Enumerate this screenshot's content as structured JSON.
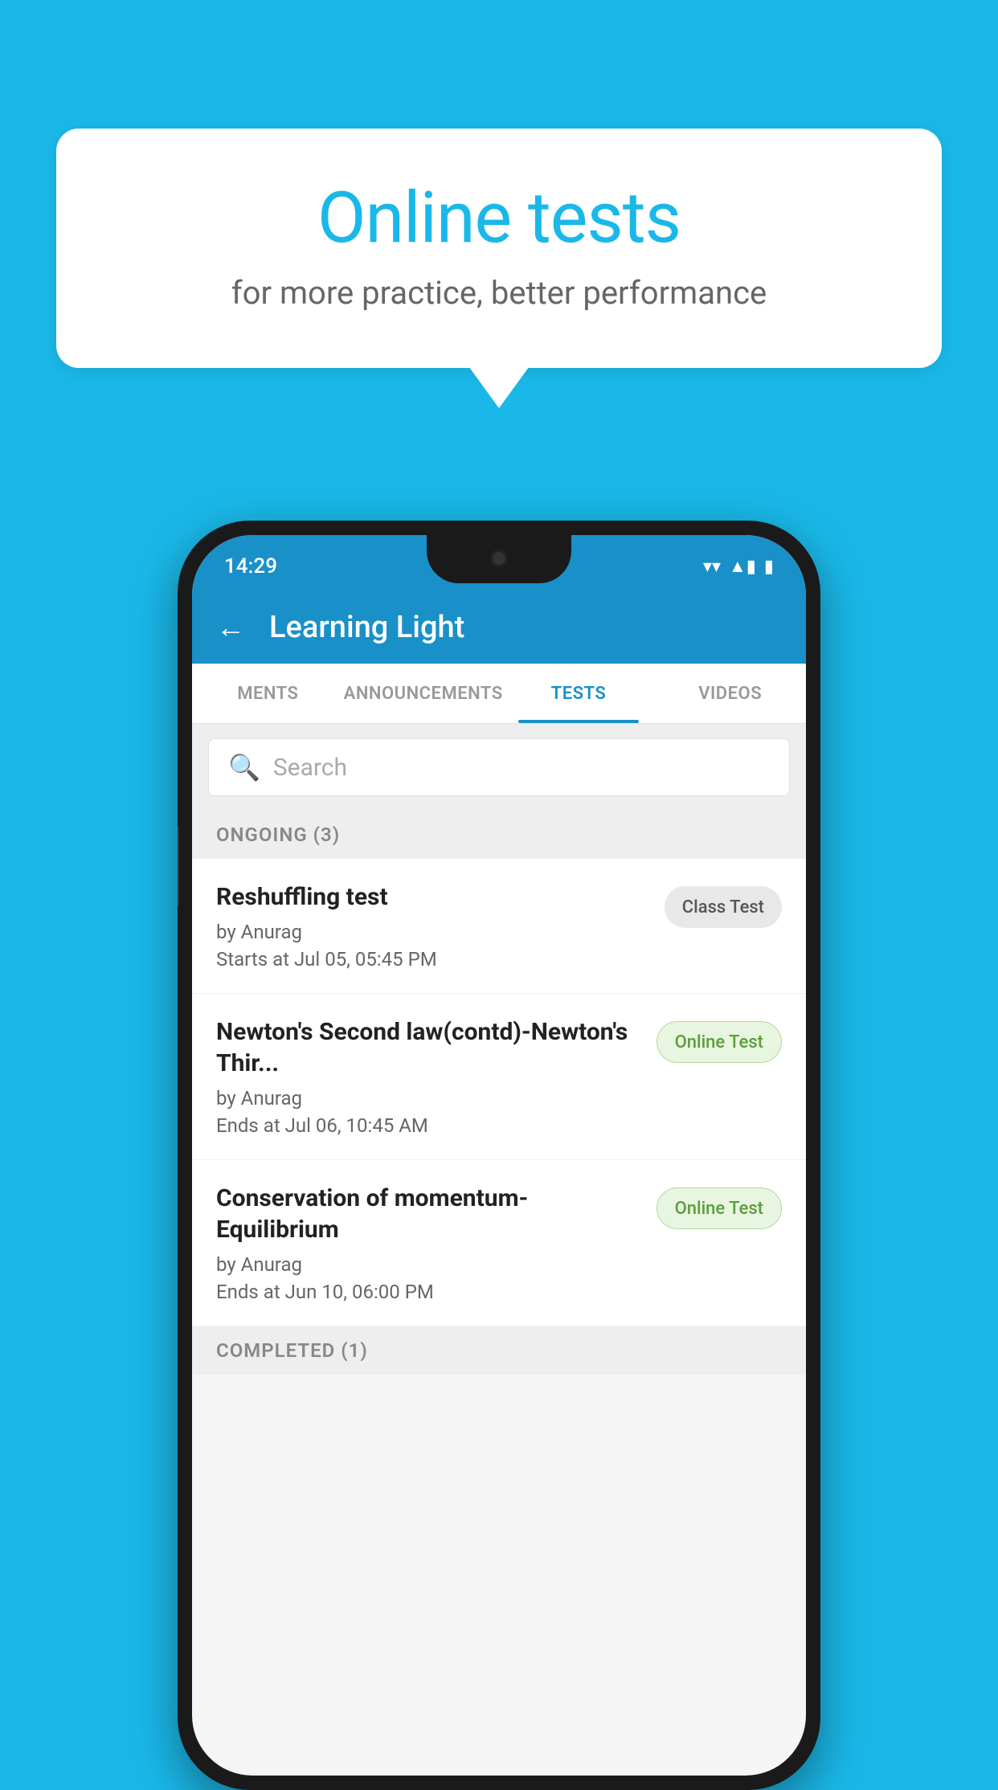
{
  "background_color": "#1ab8e8",
  "speech_bubble": {
    "title": "Online tests",
    "subtitle": "for more practice, better performance"
  },
  "phone": {
    "status_bar": {
      "time": "14:29",
      "wifi": "▾",
      "signal": "▲",
      "battery": "▮"
    },
    "app_header": {
      "back_label": "←",
      "title": "Learning Light"
    },
    "tabs": [
      {
        "label": "MENTS",
        "active": false
      },
      {
        "label": "ANNOUNCEMENTS",
        "active": false
      },
      {
        "label": "TESTS",
        "active": true
      },
      {
        "label": "VIDEOS",
        "active": false
      }
    ],
    "search": {
      "placeholder": "Search"
    },
    "ongoing_section": {
      "label": "ONGOING (3)"
    },
    "test_items": [
      {
        "name": "Reshuffling test",
        "author": "by Anurag",
        "time_label": "Starts at",
        "time": "Jul 05, 05:45 PM",
        "badge": "Class Test",
        "badge_type": "class"
      },
      {
        "name": "Newton's Second law(contd)-Newton's Thir...",
        "author": "by Anurag",
        "time_label": "Ends at",
        "time": "Jul 06, 10:45 AM",
        "badge": "Online Test",
        "badge_type": "online"
      },
      {
        "name": "Conservation of momentum-Equilibrium",
        "author": "by Anurag",
        "time_label": "Ends at",
        "time": "Jun 10, 06:00 PM",
        "badge": "Online Test",
        "badge_type": "online"
      }
    ],
    "completed_section": {
      "label": "COMPLETED (1)"
    }
  }
}
